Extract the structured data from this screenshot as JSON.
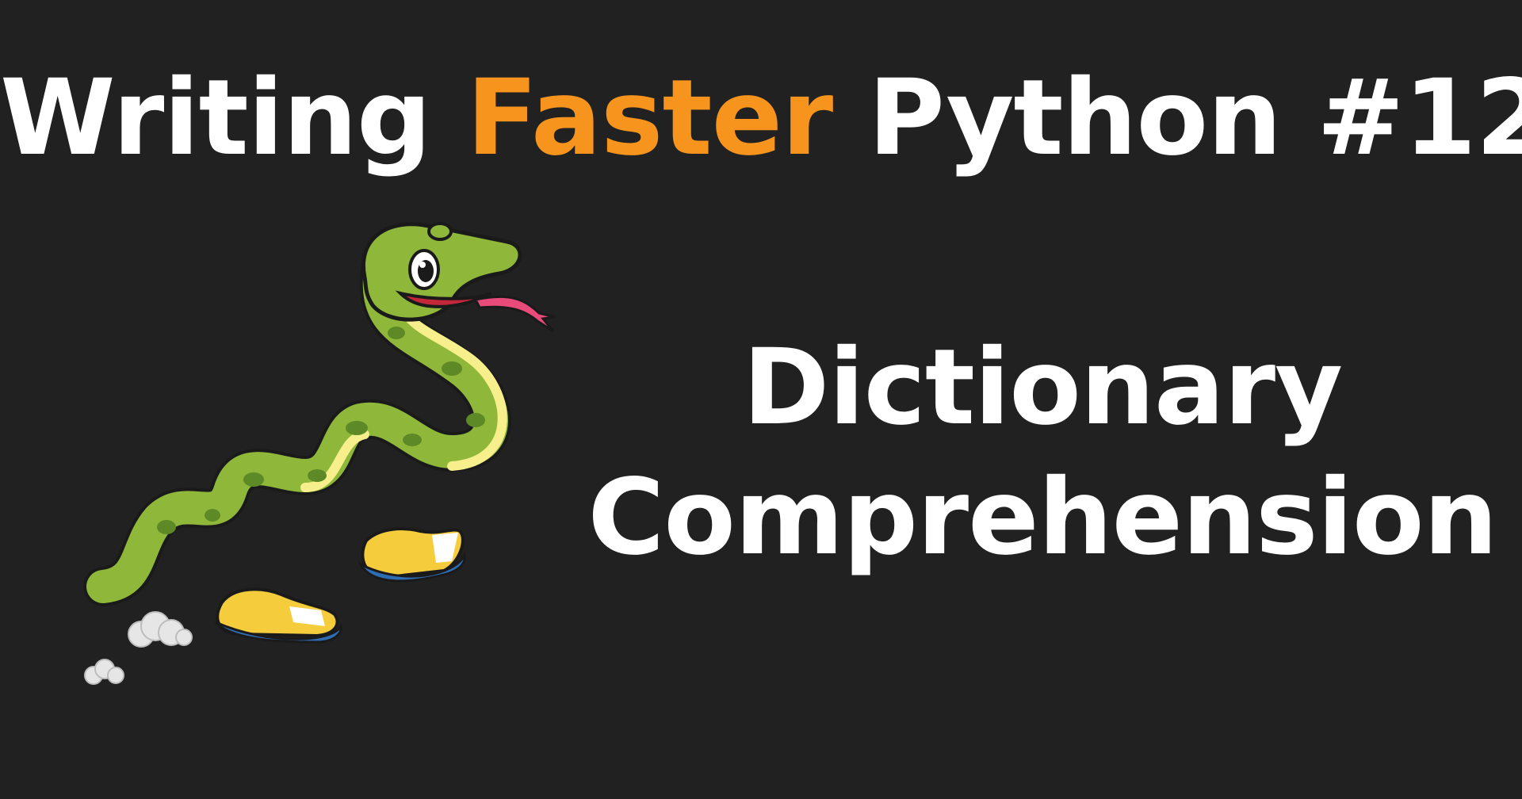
{
  "title": {
    "part1": "Writing",
    "accent": "Faster",
    "part2": "Python #12"
  },
  "subtitle": {
    "line1": "Dictionary",
    "line2": "Comprehension"
  },
  "colors": {
    "background": "#212121",
    "text": "#ffffff",
    "accent": "#f7941d",
    "snake_body": "#8fb83a",
    "snake_spots": "#5d8a27",
    "snake_belly": "#f6ef8c",
    "shoe": "#f5cc3c",
    "sole": "#2f6db3",
    "tongue": "#e84a7a"
  },
  "icons": [
    "running-snake-mascot-icon",
    "dust-cloud-icon"
  ]
}
